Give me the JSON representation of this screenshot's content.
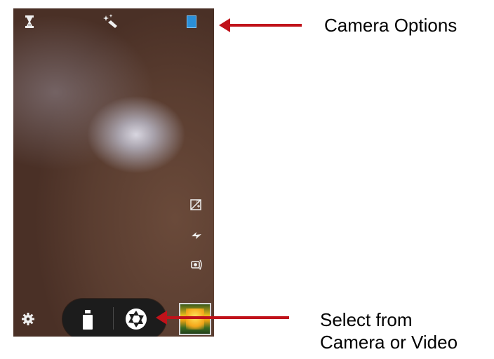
{
  "annotations": {
    "camera_options_label": "Camera Options",
    "mode_select_line1": "Select from",
    "mode_select_line2": "Camera or Video",
    "arrow_color": "#c0121a"
  },
  "top_bar": {
    "icons": [
      "panorama-icon",
      "effects-icon",
      "camera-options-icon"
    ],
    "options_icon_color": "#2a8fd8"
  },
  "side_controls": {
    "icons": [
      "hdr-icon",
      "flash-icon",
      "switch-camera-icon"
    ]
  },
  "bottom_bar": {
    "icons": [
      "settings-icon",
      "video-mode-icon",
      "shutter-icon"
    ],
    "has_gallery_thumbnail": true
  }
}
